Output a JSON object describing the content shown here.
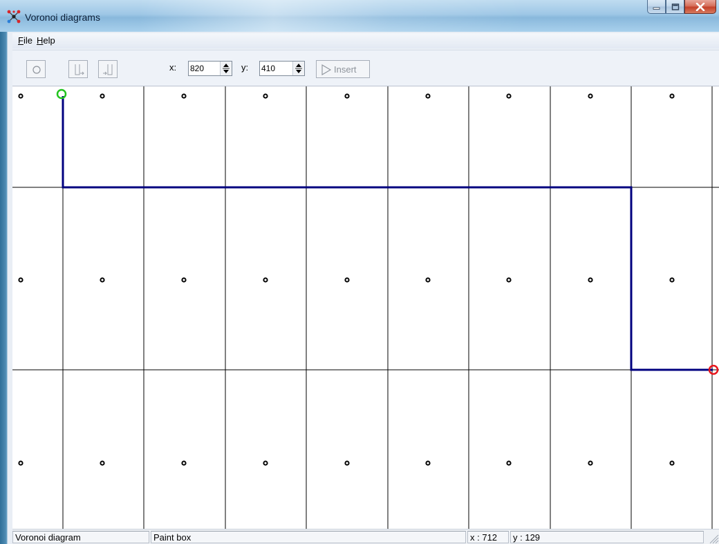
{
  "window": {
    "title": "Voronoi diagrams",
    "icon": "voronoi-app-icon"
  },
  "menu": {
    "file_prefix": "",
    "file_hotkey": "F",
    "file_rest": "ile",
    "help_hotkey": "H",
    "help_rest": "elp"
  },
  "toolbar": {
    "x_label": "x:",
    "x_value": "820",
    "y_label": "y:",
    "y_value": "410",
    "insert_label": "Insert"
  },
  "status": {
    "mode": "Voronoi diagram",
    "tool": "Paint box",
    "cursor_x": "x : 712",
    "cursor_y": "y : 129"
  },
  "diagram": {
    "site_columns": 9,
    "site_rows": 3,
    "start_marker_color": "#22c41e",
    "end_marker_color": "#e8141a",
    "path_color": "#00007f",
    "cell_edge_color": "#000000"
  }
}
